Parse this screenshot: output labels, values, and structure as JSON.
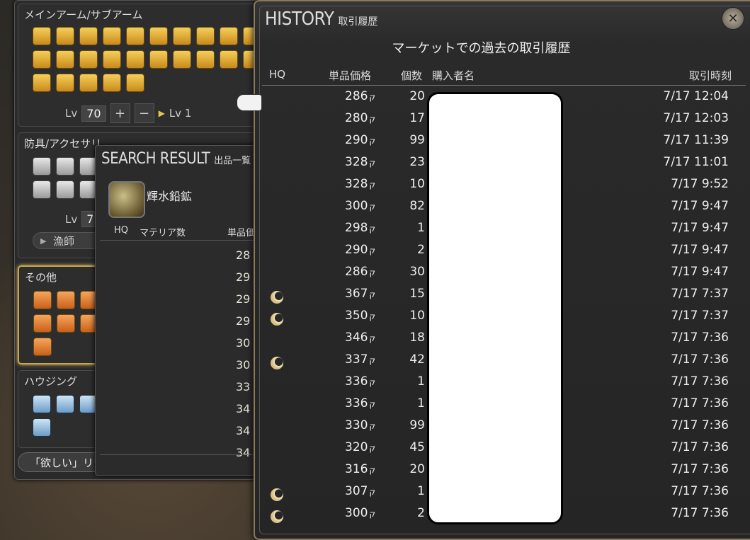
{
  "categories": {
    "main_arm": {
      "title": "メインアーム/サブアーム",
      "level_label": "Lv",
      "level_value": "70",
      "plus": "+",
      "minus": "−",
      "to_label": "Lv 1"
    },
    "armor": {
      "title": "防具/アクセサリ",
      "level_label": "Lv",
      "level_value": "7",
      "job": "漁師"
    },
    "other": {
      "title": "その他"
    },
    "housing": {
      "title": "ハウジング"
    },
    "want_button": "「欲しい」リ"
  },
  "search_result": {
    "title": "SEARCH RESULT",
    "subtitle": "出品一覧",
    "item_name": "輝水鉛鉱",
    "col_hq": "HQ",
    "col_materia": "マテリア数",
    "col_price": "単品価",
    "prices": [
      "28",
      "29",
      "29",
      "29",
      "30",
      "30",
      "33",
      "34",
      "34",
      "34"
    ]
  },
  "history": {
    "title": "HISTORY",
    "subtitle": "取引履歴",
    "heading": "マーケットでの過去の取引履歴",
    "columns": {
      "hq": "HQ",
      "price": "単品価格",
      "qty": "個数",
      "buyer": "購入者名",
      "time": "取引時刻"
    },
    "gil_symbol": "ק",
    "rows": [
      {
        "hq": false,
        "price": "286",
        "qty": "20",
        "time": "7/17 12:04"
      },
      {
        "hq": false,
        "price": "280",
        "qty": "17",
        "time": "7/17 12:03"
      },
      {
        "hq": false,
        "price": "290",
        "qty": "99",
        "time": "7/17 11:39"
      },
      {
        "hq": false,
        "price": "328",
        "qty": "23",
        "time": "7/17 11:01"
      },
      {
        "hq": false,
        "price": "328",
        "qty": "10",
        "time": "7/17 9:52"
      },
      {
        "hq": false,
        "price": "300",
        "qty": "82",
        "time": "7/17 9:47"
      },
      {
        "hq": false,
        "price": "298",
        "qty": "1",
        "time": "7/17 9:47"
      },
      {
        "hq": false,
        "price": "290",
        "qty": "2",
        "time": "7/17 9:47"
      },
      {
        "hq": false,
        "price": "286",
        "qty": "30",
        "time": "7/17 9:47"
      },
      {
        "hq": true,
        "price": "367",
        "qty": "15",
        "time": "7/17 7:37"
      },
      {
        "hq": true,
        "price": "350",
        "qty": "10",
        "time": "7/17 7:37"
      },
      {
        "hq": false,
        "price": "346",
        "qty": "18",
        "time": "7/17 7:36"
      },
      {
        "hq": true,
        "price": "337",
        "qty": "42",
        "time": "7/17 7:36"
      },
      {
        "hq": false,
        "price": "336",
        "qty": "1",
        "time": "7/17 7:36"
      },
      {
        "hq": false,
        "price": "336",
        "qty": "1",
        "time": "7/17 7:36"
      },
      {
        "hq": false,
        "price": "330",
        "qty": "99",
        "time": "7/17 7:36"
      },
      {
        "hq": false,
        "price": "320",
        "qty": "45",
        "time": "7/17 7:36"
      },
      {
        "hq": false,
        "price": "316",
        "qty": "20",
        "time": "7/17 7:36"
      },
      {
        "hq": true,
        "price": "307",
        "qty": "1",
        "time": "7/17 7:36"
      },
      {
        "hq": true,
        "price": "300",
        "qty": "2",
        "time": "7/17 7:36"
      }
    ]
  },
  "icons": {
    "main_arm": [
      "swords-icon",
      "axe-icon",
      "fist-icon",
      "lance-icon",
      "hammer-icon",
      "chakram-icon",
      "gun-icon",
      "bow-icon",
      "staff-icon",
      "book-icon",
      "scythe-icon",
      "mask-icon",
      "pick-icon",
      "wand-icon",
      "sword-icon",
      "crossbow-icon",
      "helm-icon",
      "tome-icon",
      "leaf-icon",
      "bell-icon",
      "pot-icon",
      "pickaxe-icon",
      "knife-icon",
      "quill-icon",
      "sickle-icon"
    ],
    "armor": [
      "shield-icon",
      "hat-icon",
      "body-icon",
      "ring-icon",
      "necklace-icon",
      "gem-icon"
    ],
    "other": [
      "potion-icon",
      "food-icon",
      "fork-icon",
      "bell-icon",
      "pot-icon",
      "gear-icon",
      "music-icon"
    ],
    "housing": [
      "furniture-icon",
      "table-icon",
      "wall-icon",
      "painting-icon"
    ]
  }
}
